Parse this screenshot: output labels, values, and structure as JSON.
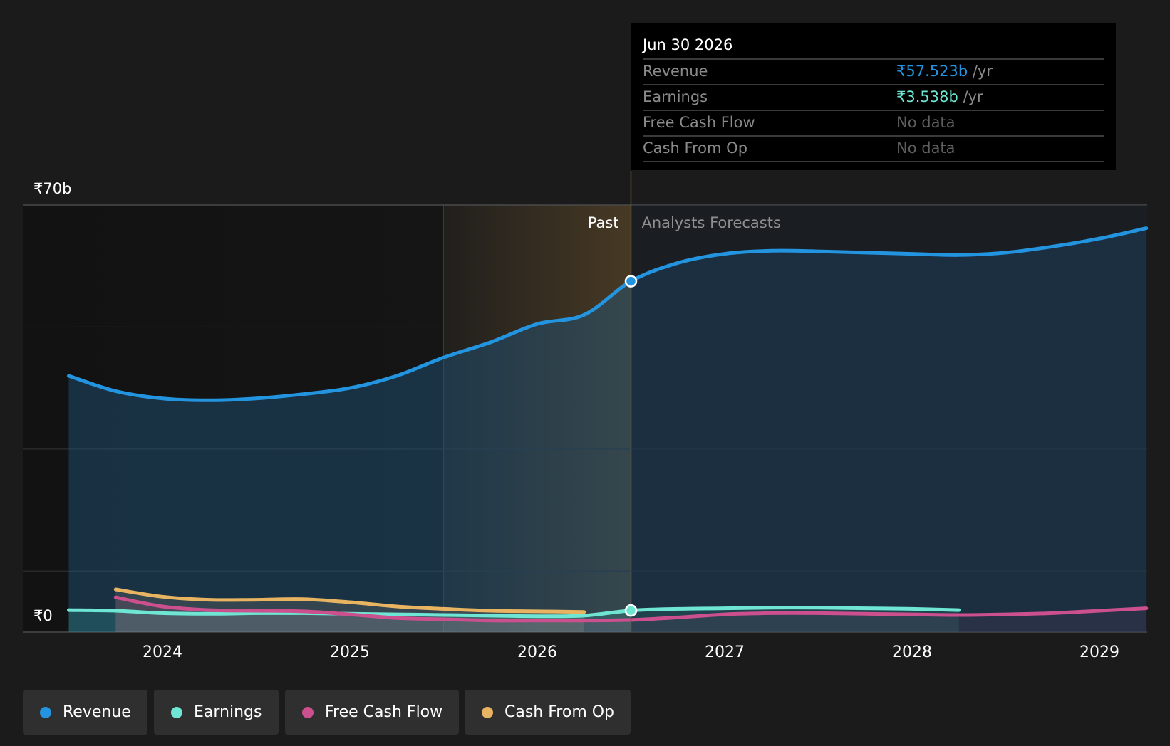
{
  "chart_data": {
    "type": "area",
    "x_unit": "year",
    "y_axis": {
      "top_label": "₹70b",
      "bottom_label": "₹0",
      "ylim": [
        0,
        70
      ]
    },
    "x_ticks": [
      "2024",
      "2025",
      "2026",
      "2027",
      "2028",
      "2029"
    ],
    "past_label": "Past",
    "forecast_label": "Analysts Forecasts",
    "divider_x": 2026.5,
    "highlight_start_x": 2025.5,
    "colors": {
      "revenue": "#2394df",
      "earnings": "#6ee6d3",
      "free_cash_flow": "#cc4f8e",
      "cash_from_op": "#e8b462",
      "highlight": "#e3a646"
    },
    "series": [
      {
        "name": "Revenue",
        "key": "revenue",
        "points": [
          [
            2023.5,
            42.0
          ],
          [
            2023.75,
            39.5
          ],
          [
            2024.0,
            38.3
          ],
          [
            2024.25,
            38.0
          ],
          [
            2024.5,
            38.3
          ],
          [
            2024.75,
            39.0
          ],
          [
            2025.0,
            40.0
          ],
          [
            2025.25,
            42.0
          ],
          [
            2025.5,
            45.0
          ],
          [
            2025.75,
            47.5
          ],
          [
            2026.0,
            50.5
          ],
          [
            2026.25,
            52.0
          ],
          [
            2026.5,
            57.5
          ],
          [
            2026.75,
            60.5
          ],
          [
            2027.0,
            62.0
          ],
          [
            2027.25,
            62.5
          ],
          [
            2027.5,
            62.4
          ],
          [
            2027.75,
            62.2
          ],
          [
            2028.0,
            62.0
          ],
          [
            2028.25,
            61.8
          ],
          [
            2028.5,
            62.2
          ],
          [
            2028.75,
            63.2
          ],
          [
            2029.0,
            64.5
          ],
          [
            2029.25,
            66.2
          ]
        ],
        "forecast_from_x": 2026.5
      },
      {
        "name": "Earnings",
        "key": "earnings",
        "points": [
          [
            2023.5,
            3.6
          ],
          [
            2023.75,
            3.5
          ],
          [
            2024.0,
            3.1
          ],
          [
            2024.25,
            3.0
          ],
          [
            2024.5,
            3.1
          ],
          [
            2024.75,
            3.1
          ],
          [
            2025.0,
            3.0
          ],
          [
            2025.25,
            2.9
          ],
          [
            2025.5,
            2.8
          ],
          [
            2025.75,
            2.7
          ],
          [
            2026.0,
            2.6
          ],
          [
            2026.25,
            2.7
          ],
          [
            2026.5,
            3.538
          ],
          [
            2026.75,
            3.8
          ],
          [
            2027.0,
            3.9
          ],
          [
            2027.25,
            4.0
          ],
          [
            2027.5,
            4.0
          ],
          [
            2027.75,
            3.9
          ],
          [
            2028.0,
            3.8
          ],
          [
            2028.25,
            3.6
          ]
        ],
        "forecast_from_x": 2026.5
      },
      {
        "name": "Free Cash Flow",
        "key": "free_cash_flow",
        "points": [
          [
            2023.75,
            5.7
          ],
          [
            2024.0,
            4.2
          ],
          [
            2024.25,
            3.6
          ],
          [
            2024.5,
            3.5
          ],
          [
            2024.75,
            3.4
          ],
          [
            2025.0,
            2.9
          ],
          [
            2025.25,
            2.3
          ],
          [
            2025.5,
            2.1
          ],
          [
            2025.75,
            1.9
          ],
          [
            2026.0,
            1.9
          ],
          [
            2026.25,
            1.9
          ],
          [
            2026.5,
            2.0
          ],
          [
            2026.75,
            2.4
          ],
          [
            2027.0,
            2.9
          ],
          [
            2027.25,
            3.1
          ],
          [
            2027.5,
            3.1
          ],
          [
            2027.75,
            3.0
          ],
          [
            2028.0,
            2.9
          ],
          [
            2028.25,
            2.8
          ],
          [
            2028.5,
            2.9
          ],
          [
            2028.75,
            3.1
          ],
          [
            2029.0,
            3.5
          ],
          [
            2029.25,
            3.9
          ]
        ],
        "forecast_from_x": 2026.5
      },
      {
        "name": "Cash From Op",
        "key": "cash_from_op",
        "points": [
          [
            2023.75,
            7.0
          ],
          [
            2024.0,
            5.8
          ],
          [
            2024.25,
            5.3
          ],
          [
            2024.5,
            5.3
          ],
          [
            2024.75,
            5.4
          ],
          [
            2025.0,
            4.9
          ],
          [
            2025.25,
            4.2
          ],
          [
            2025.5,
            3.8
          ],
          [
            2025.75,
            3.5
          ],
          [
            2026.0,
            3.4
          ],
          [
            2026.25,
            3.3
          ]
        ]
      }
    ]
  },
  "tooltip": {
    "date": "Jun 30 2026",
    "rows": [
      {
        "label": "Revenue",
        "value": "₹57.523b",
        "unit": " /yr"
      },
      {
        "label": "Earnings",
        "value": "₹3.538b",
        "unit": " /yr"
      },
      {
        "label": "Free Cash Flow",
        "value": "No data",
        "unit": ""
      },
      {
        "label": "Cash From Op",
        "value": "No data",
        "unit": ""
      }
    ]
  },
  "legend": [
    {
      "label": "Revenue",
      "key": "revenue"
    },
    {
      "label": "Earnings",
      "key": "earnings"
    },
    {
      "label": "Free Cash Flow",
      "key": "free_cash_flow"
    },
    {
      "label": "Cash From Op",
      "key": "cash_from_op"
    }
  ]
}
